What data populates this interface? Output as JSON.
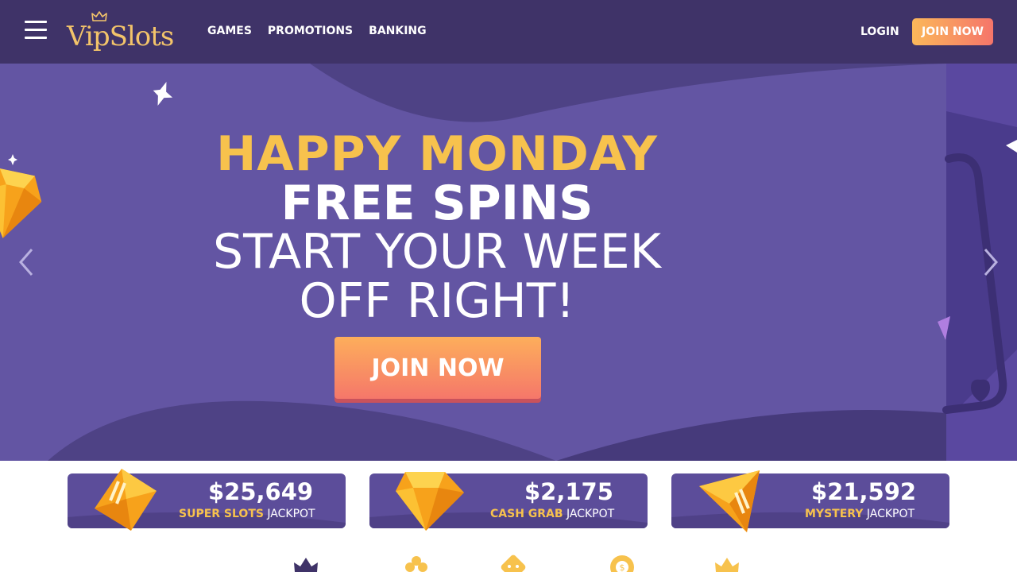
{
  "header": {
    "logo_text": "VipSlots",
    "nav": [
      "GAMES",
      "PROMOTIONS",
      "BANKING"
    ],
    "login_label": "LOGIN",
    "join_label": "JOIN NOW"
  },
  "hero": {
    "line1": "HAPPY MONDAY",
    "line2": "FREE SPINS",
    "line3": "START YOUR WEEK",
    "line4": "OFF RIGHT!",
    "cta_label": "JOIN NOW"
  },
  "jackpots": [
    {
      "amount": "$25,649",
      "name": "SUPER SLOTS",
      "suffix": "JACKPOT"
    },
    {
      "amount": "$2,175",
      "name": "CASH GRAB",
      "suffix": "JACKPOT"
    },
    {
      "amount": "$21,592",
      "name": "MYSTERY",
      "suffix": "JACKPOT"
    }
  ],
  "colors": {
    "header_bg": "#3f3368",
    "hero_bg": "#6355a3",
    "accent_gold": "#f7c24d",
    "cta_orange": "#f5776a",
    "jackpot_bg": "#5c4d9a"
  },
  "icons": [
    "menu-icon",
    "crown-icon",
    "chevron-left-icon",
    "chevron-right-icon",
    "gem-icon",
    "clover-icon",
    "dice-icon",
    "chip-icon"
  ]
}
